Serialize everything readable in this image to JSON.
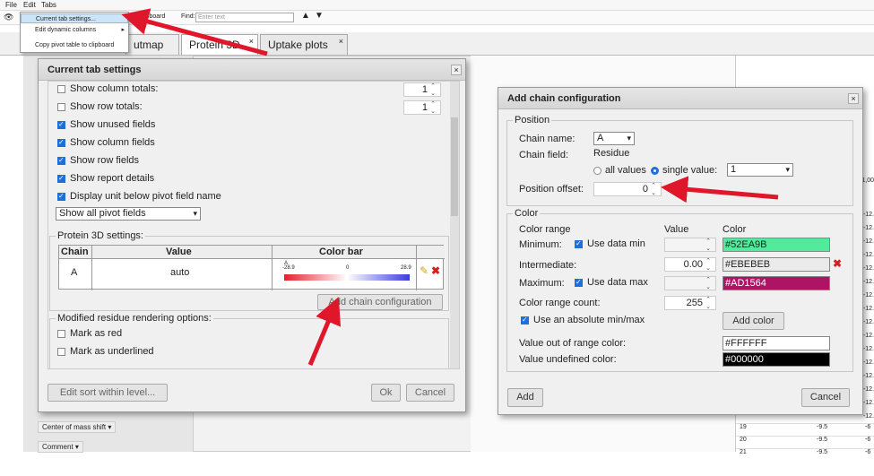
{
  "menu": {
    "file": "File",
    "edit": "Edit",
    "tabs": "Tabs"
  },
  "toolbar": {
    "clipboard": "clipboard",
    "find_label": "Find:",
    "find_placeholder": "Enter text"
  },
  "edit_menu": {
    "items": [
      "Current tab settings...",
      "Edit dynamic columns",
      "Copy pivot table to clipboard"
    ]
  },
  "tabs": [
    {
      "label": "utmap"
    },
    {
      "label": "Protein 3D"
    },
    {
      "label": "Uptake plots"
    }
  ],
  "left_bottom": {
    "center_mass": "Center of mass shift",
    "comment": "Comment"
  },
  "right_table": {
    "rows": [
      {
        "num": "19",
        "a": "-9.5",
        "b": "-6"
      },
      {
        "num": "20",
        "a": "-9.5",
        "b": "-6"
      },
      {
        "num": "21",
        "a": "-9.5",
        "b": "-6"
      }
    ],
    "side_values": [
      "-12.",
      "-12.",
      "-12.",
      "-12.",
      "-12.",
      "-12.",
      "-12.",
      "-12.",
      "-12.",
      "-12.",
      "-12.",
      "-12.",
      "-12.",
      "-12.",
      "-12.",
      "-12."
    ],
    "top_value": "1,00"
  },
  "settings": {
    "title": "Current tab settings",
    "options": [
      {
        "label": "Show column totals:",
        "checked": false,
        "value": "1"
      },
      {
        "label": "Show row totals:",
        "checked": false,
        "value": "1"
      },
      {
        "label": "Show unused fields",
        "checked": true
      },
      {
        "label": "Show column fields",
        "checked": true
      },
      {
        "label": "Show row fields",
        "checked": true
      },
      {
        "label": "Show report details",
        "checked": true
      },
      {
        "label": "Display unit below pivot field name",
        "checked": true
      }
    ],
    "pivot_select": "Show all pivot fields",
    "p3d_label": "Protein 3D settings:",
    "table": {
      "headers": [
        "Chain",
        "Value",
        "Color bar"
      ],
      "row": {
        "chain": "A",
        "value": "auto",
        "bar_min": "-28.9",
        "bar_mid": "0",
        "bar_max": "28.9",
        "bar_top": "A"
      }
    },
    "add_chain_btn": "Add chain configuration",
    "modified_label": "Modified residue rendering options:",
    "mark_red": "Mark as red",
    "mark_underlined": "Mark as underlined",
    "edit_sort_btn": "Edit sort within level...",
    "ok_btn": "Ok",
    "cancel_btn": "Cancel"
  },
  "chain": {
    "title": "Add chain configuration",
    "position_label": "Position",
    "chain_name_label": "Chain name:",
    "chain_name_value": "A",
    "chain_field_label": "Chain field:",
    "chain_field_value": "Residue",
    "all_values": "all values",
    "single_value": "single value:",
    "single_value_value": "1",
    "offset_label": "Position offset:",
    "offset_value": "0",
    "color_label": "Color",
    "color_range": "Color range",
    "value_header": "Value",
    "color_header": "Color",
    "minimum": "Minimum:",
    "use_min": "Use data min",
    "min_color": "#52EA9B",
    "intermediate": "Intermediate:",
    "inter_value": "0.00",
    "inter_color": "#EBEBEB",
    "maximum": "Maximum:",
    "use_max": "Use data max",
    "max_color": "#AD1564",
    "range_count_label": "Color range count:",
    "range_count": "255",
    "abs_minmax": "Use an absolute min/max",
    "add_color_btn": "Add color",
    "out_range_label": "Value out of range color:",
    "out_range_color": "#FFFFFF",
    "undefined_label": "Value undefined color:",
    "undefined_color": "#000000",
    "add_btn": "Add",
    "cancel_btn": "Cancel"
  },
  "colors": {
    "arrow": "#e0162b",
    "accent": "#1e6fd9",
    "menu_highlight": "#cce4f7"
  }
}
